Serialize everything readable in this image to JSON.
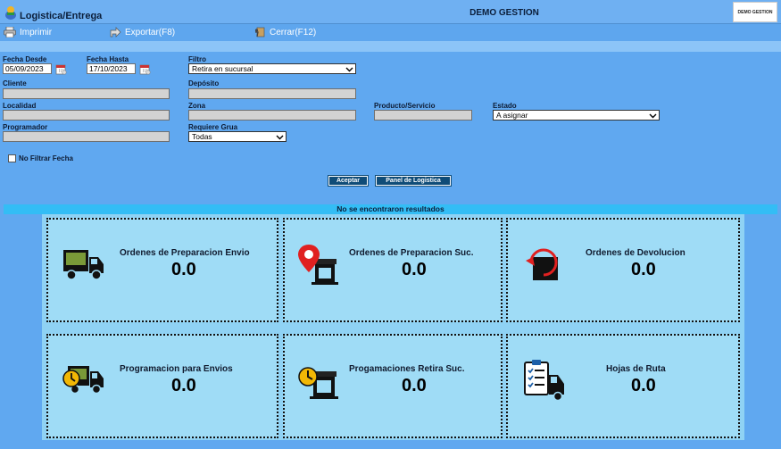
{
  "app": {
    "title": "Logistica/Entrega",
    "center_title": "DEMO GESTION",
    "brand": "DEMO GESTION"
  },
  "toolbar": {
    "print": "Imprimir",
    "export": "Exportar(F8)",
    "close": "Cerrar(F12)"
  },
  "filters": {
    "fecha_desde_label": "Fecha Desde",
    "fecha_desde_value": "05/09/2023",
    "fecha_hasta_label": "Fecha Hasta",
    "fecha_hasta_value": "17/10/2023",
    "filtro_label": "Filtro",
    "filtro_value": "Retira en sucursal",
    "cliente_label": "Cliente",
    "cliente_value": "",
    "deposito_label": "Depósito",
    "deposito_value": "",
    "localidad_label": "Localidad",
    "localidad_value": "",
    "zona_label": "Zona",
    "zona_value": "",
    "producto_label": "Producto/Servicio",
    "producto_value": "",
    "estado_label": "Estado",
    "estado_value": "A asignar",
    "programador_label": "Programador",
    "programador_value": "",
    "grua_label": "Requiere Grua",
    "grua_value": "Todas",
    "no_filtrar_label": "No Filtrar Fecha"
  },
  "buttons": {
    "aceptar": "Aceptar",
    "panel": "Panel de Logistica"
  },
  "results": {
    "message": "No se encontraron resultados"
  },
  "cards": [
    {
      "title": "Ordenes de Preparacion Envio",
      "value": "0.0",
      "icon": "truck-icon"
    },
    {
      "title": "Ordenes de Preparacion Suc.",
      "value": "0.0",
      "icon": "store-pin-icon"
    },
    {
      "title": "Ordenes de Devolucion",
      "value": "0.0",
      "icon": "return-box-icon"
    },
    {
      "title": "Programacion para Envios",
      "value": "0.0",
      "icon": "truck-clock-icon"
    },
    {
      "title": "Progamaciones Retira Suc.",
      "value": "0.0",
      "icon": "store-clock-icon"
    },
    {
      "title": "Hojas de Ruta",
      "value": "0.0",
      "icon": "route-sheet-truck-icon"
    }
  ],
  "colors": {
    "background": "#60a8f0",
    "results_bar": "#33bdf5",
    "card_bg": "#9fdcf6",
    "button": "#0f4c78"
  }
}
